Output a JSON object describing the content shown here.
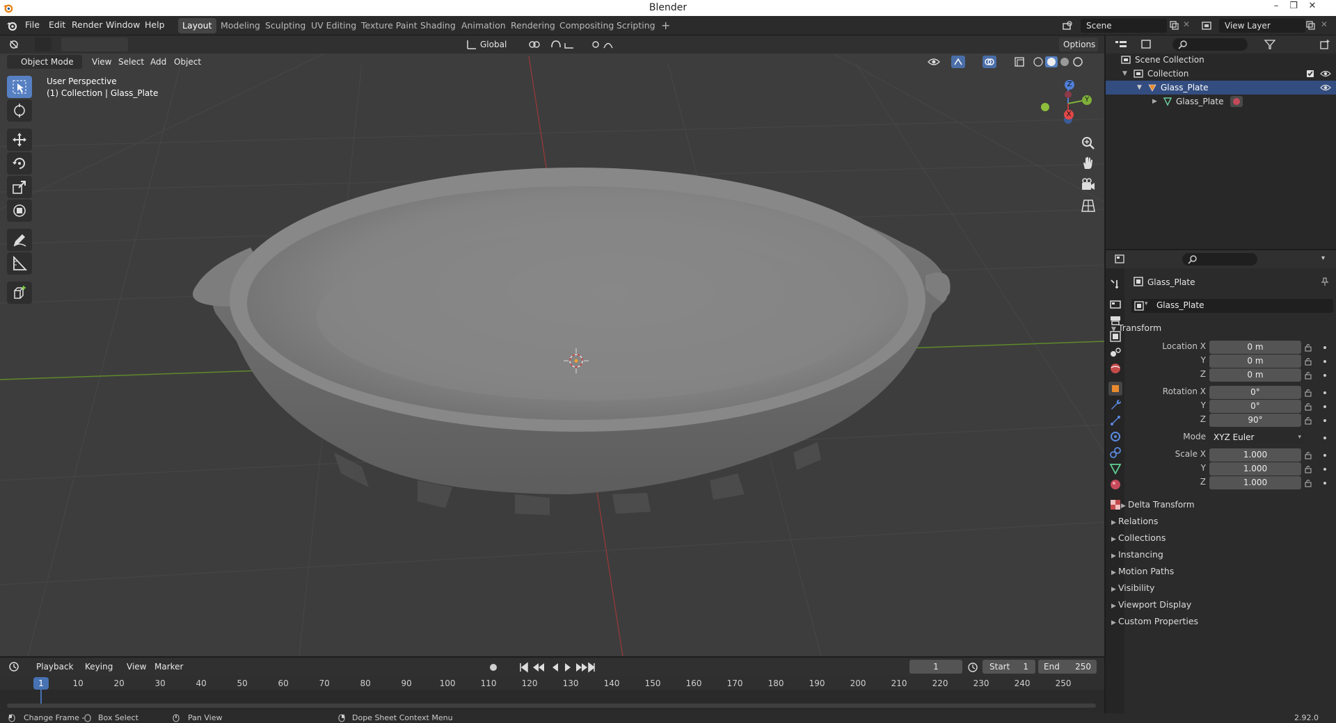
{
  "window": {
    "title": "Blender",
    "minimize": "–",
    "restore": "❐",
    "close": "✕"
  },
  "menu": [
    "File",
    "Edit",
    "Render",
    "Window",
    "Help"
  ],
  "workspaces": [
    "Layout",
    "Modeling",
    "Sculpting",
    "UV Editing",
    "Texture Paint",
    "Shading",
    "Animation",
    "Rendering",
    "Compositing",
    "Scripting"
  ],
  "active_workspace": "Layout",
  "scene": {
    "name": "Scene",
    "view_layer": "View Layer"
  },
  "viewport": {
    "transform_orientation": "Global",
    "options": "Options",
    "mode": "Object Mode",
    "menus": [
      "View",
      "Select",
      "Add",
      "Object"
    ],
    "perspective": "User Perspective",
    "collection_info": "(1) Collection | Glass_Plate"
  },
  "gizmo": {
    "z": "Z",
    "y": "Y",
    "x": "X"
  },
  "outliner": {
    "scene_collection": "Scene Collection",
    "collection": "Collection",
    "object": "Glass_Plate",
    "mesh": "Glass_Plate"
  },
  "properties": {
    "object_name": "Glass_Plate",
    "object_field": "Glass_Plate",
    "transform_title": "Transform",
    "location_label": "Location X",
    "rotation_label": "Rotation X",
    "scale_label": "Scale X",
    "y_label": "Y",
    "z_label": "Z",
    "location": [
      "0 m",
      "0 m",
      "0 m"
    ],
    "rotation": [
      "0°",
      "0°",
      "90°"
    ],
    "mode_label": "Mode",
    "mode_value": "XYZ Euler",
    "scale": [
      "1.000",
      "1.000",
      "1.000"
    ],
    "delta_transform": "Delta Transform",
    "sections": [
      "Relations",
      "Collections",
      "Instancing",
      "Motion Paths",
      "Visibility",
      "Viewport Display",
      "Custom Properties"
    ]
  },
  "timeline": {
    "menus": [
      "Playback",
      "Keying",
      "View",
      "Marker"
    ],
    "current_frame": "1",
    "start_label": "Start",
    "start": "1",
    "end_label": "End",
    "end": "250",
    "ticks": [
      "10",
      "20",
      "30",
      "40",
      "50",
      "60",
      "70",
      "80",
      "90",
      "100",
      "110",
      "120",
      "130",
      "140",
      "150",
      "160",
      "170",
      "180",
      "190",
      "200",
      "210",
      "220",
      "230",
      "240",
      "250"
    ],
    "playhead": "1"
  },
  "status": {
    "change_frame": "Change Frame",
    "box_select": "Box Select",
    "pan_view": "Pan View",
    "context_menu": "Dope Sheet Context Menu",
    "version": "2.92.0"
  }
}
